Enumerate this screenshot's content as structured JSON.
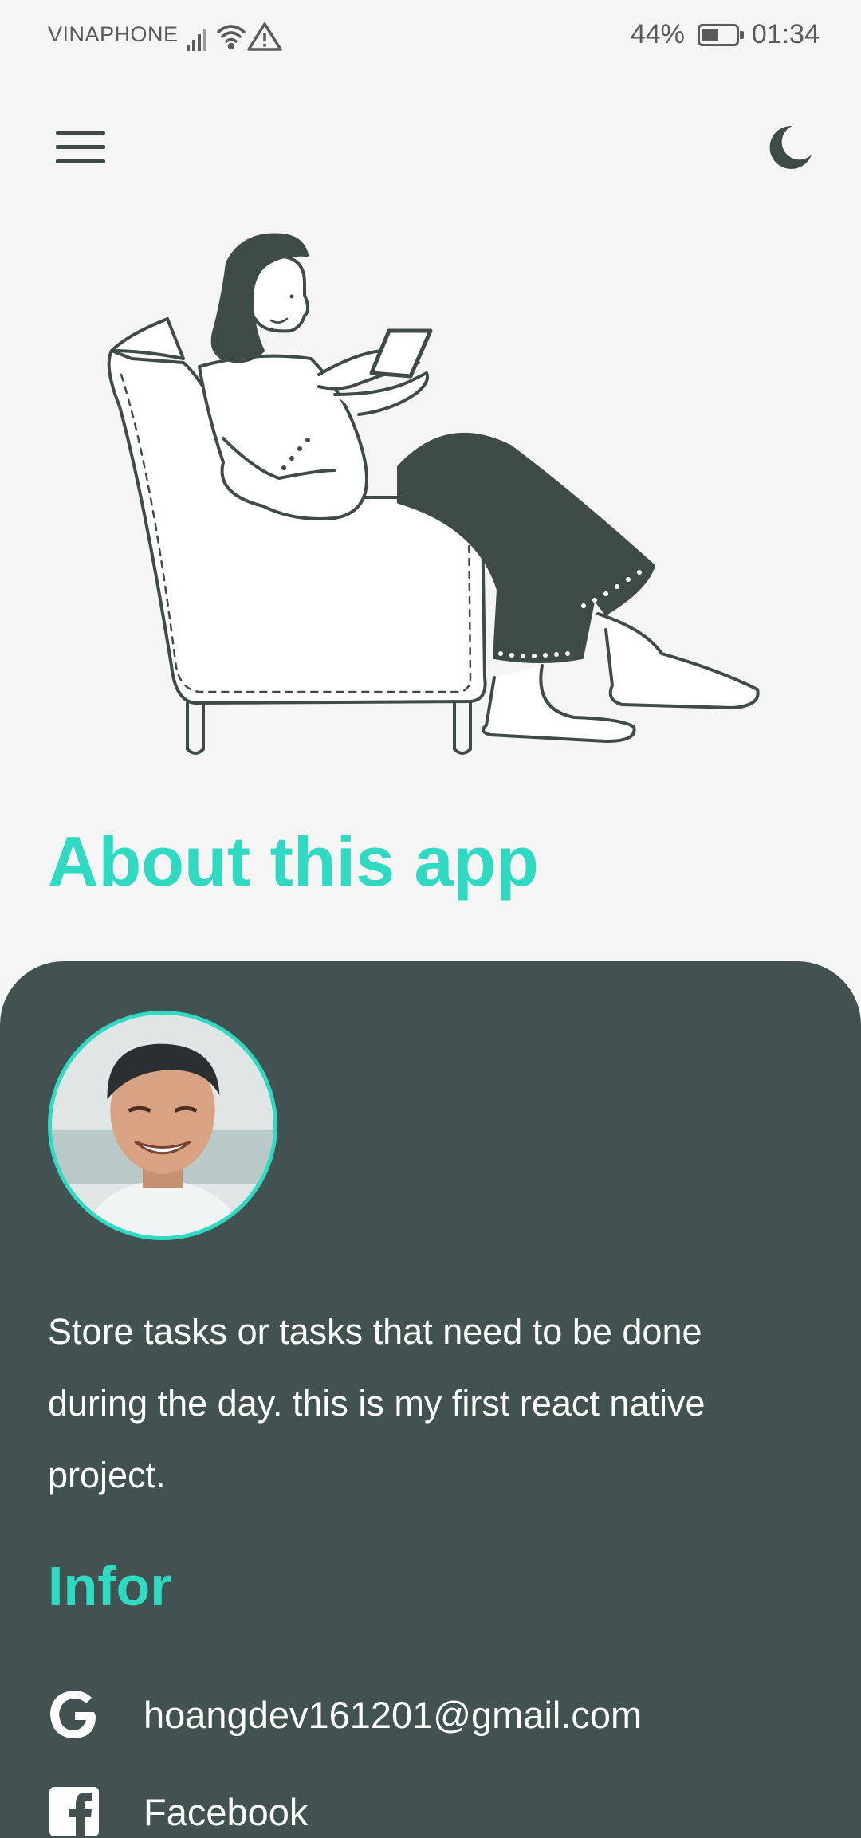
{
  "status_bar": {
    "carrier": "VINAPHONE",
    "battery_percent": "44%",
    "time": "01:34",
    "icons": [
      "signal-icon",
      "wifi-icon",
      "warning-icon",
      "battery-icon"
    ]
  },
  "app_bar": {
    "menu_icon": "hamburger-menu-icon",
    "theme_icon": "moon-icon"
  },
  "illustration": "woman-sitting-in-armchair-using-phone",
  "page": {
    "title": "About this app",
    "description": "Store tasks or tasks that need to be done during the day. this is my first react native project.",
    "section_title": "Infor"
  },
  "contacts": [
    {
      "icon": "google-icon",
      "label": "hoangdev161201@gmail.com"
    },
    {
      "icon": "facebook-icon",
      "label": "Facebook"
    }
  ],
  "colors": {
    "accent": "#2fd9c2",
    "card_background": "#415250",
    "page_background": "#f5f5f5",
    "ink": "#3e4b48"
  }
}
